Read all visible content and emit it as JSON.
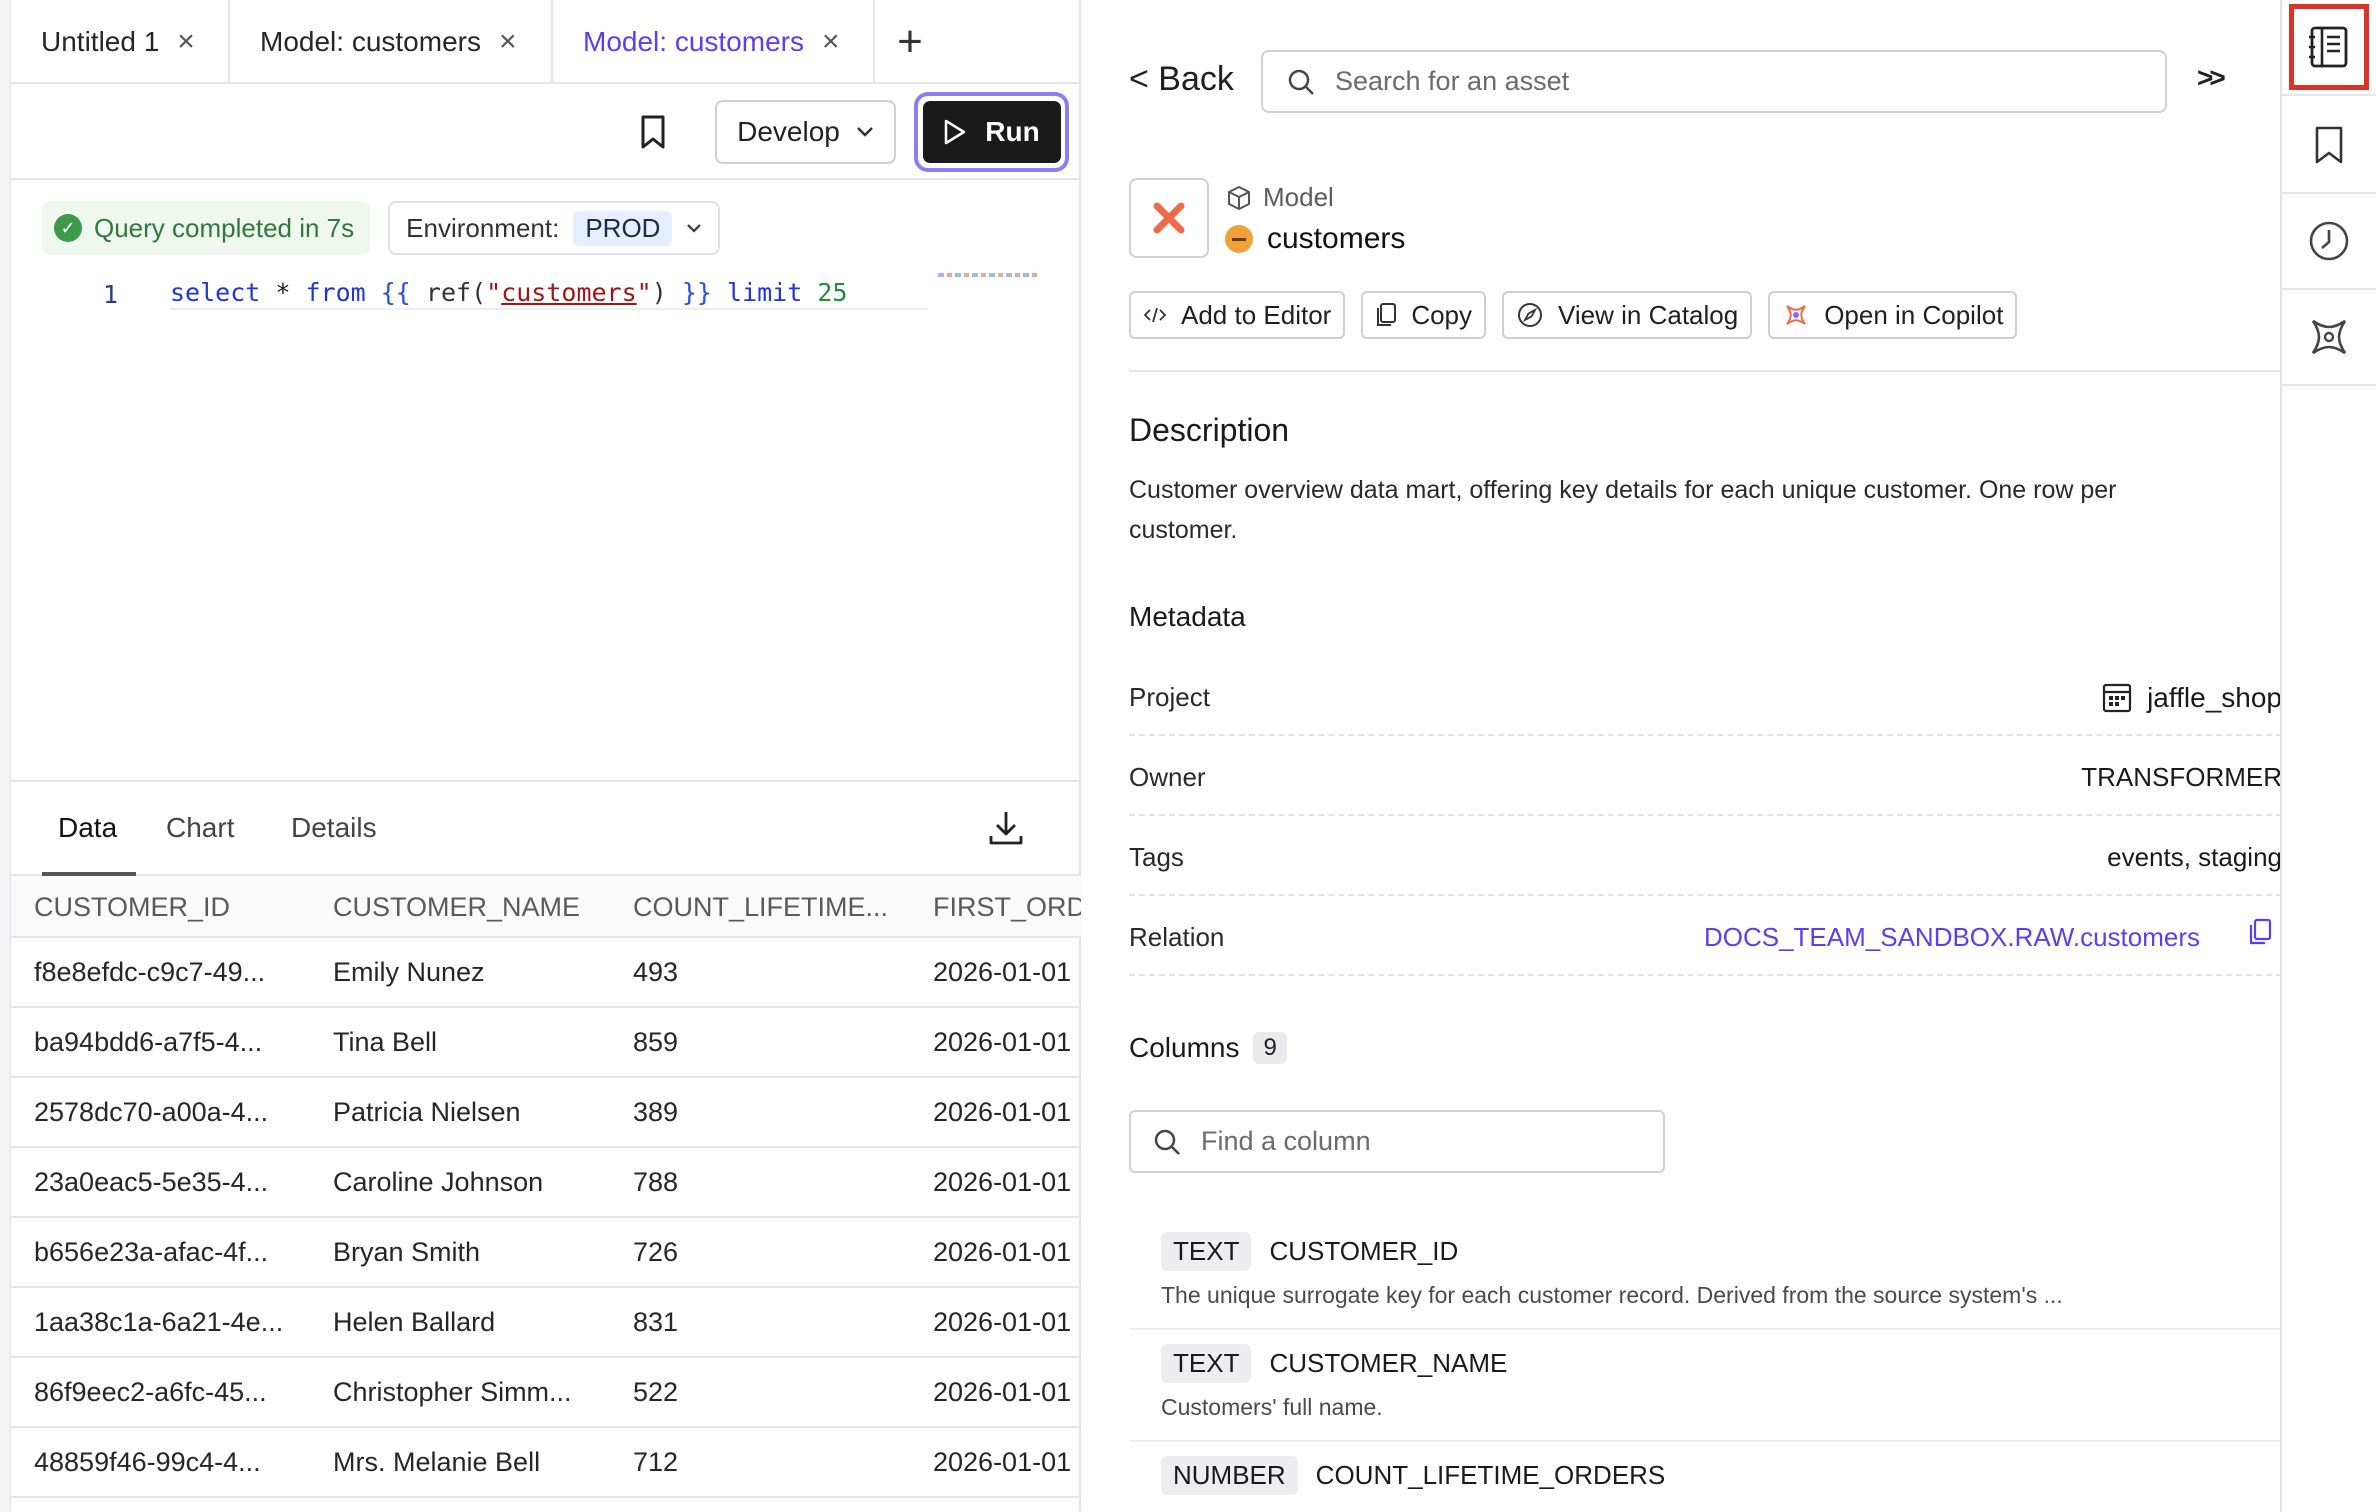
{
  "tabs": [
    {
      "label": "Untitled 1"
    },
    {
      "label": "Model: customers"
    },
    {
      "label": "Model: customers",
      "active": true
    }
  ],
  "toolbar": {
    "develop_label": "Develop",
    "run_label": "Run"
  },
  "status": {
    "query_text": "Query completed in 7s",
    "env_label": "Environment:",
    "env_value": "PROD"
  },
  "editor": {
    "line_number": "1",
    "code": "select * from {{ ref(\"customers\") }} limit 25"
  },
  "results": {
    "tabs": [
      "Data",
      "Chart",
      "Details"
    ],
    "active_tab": "Data",
    "columns": [
      "CUSTOMER_ID",
      "CUSTOMER_NAME",
      "COUNT_LIFETIME...",
      "FIRST_ORDI"
    ],
    "rows": [
      [
        "f8e8efdc-c9c7-49...",
        "Emily Nunez",
        "493",
        "2026-01-01"
      ],
      [
        "ba94bdd6-a7f5-4...",
        "Tina Bell",
        "859",
        "2026-01-01"
      ],
      [
        "2578dc70-a00a-4...",
        "Patricia Nielsen",
        "389",
        "2026-01-01"
      ],
      [
        "23a0eac5-5e35-4...",
        "Caroline Johnson",
        "788",
        "2026-01-01"
      ],
      [
        "b656e23a-afac-4f...",
        "Bryan Smith",
        "726",
        "2026-01-01"
      ],
      [
        "1aa38c1a-6a21-4e...",
        "Helen Ballard",
        "831",
        "2026-01-01"
      ],
      [
        "86f9eec2-a6fc-45...",
        "Christopher Simm...",
        "522",
        "2026-01-01"
      ],
      [
        "48859f46-99c4-4...",
        "Mrs. Melanie Bell",
        "712",
        "2026-01-01"
      ]
    ]
  },
  "catalog": {
    "back_label": "< Back",
    "search_placeholder": "Search for an asset",
    "collapse_label": ">>",
    "asset_type": "Model",
    "asset_name": "customers",
    "actions": {
      "add_to_editor": "Add to Editor",
      "copy": "Copy",
      "view_in_catalog": "View in Catalog",
      "open_in_copilot": "Open in Copilot"
    },
    "description_title": "Description",
    "description": "Customer overview data mart, offering key details for each unique customer. One row per customer.",
    "metadata_title": "Metadata",
    "metadata": {
      "project_label": "Project",
      "project_value": "jaffle_shop",
      "owner_label": "Owner",
      "owner_value": "TRANSFORMER",
      "tags_label": "Tags",
      "tags_value": "events, staging",
      "relation_label": "Relation",
      "relation_value": "DOCS_TEAM_SANDBOX.RAW.customers"
    },
    "columns_title": "Columns",
    "columns_count": "9",
    "column_search_placeholder": "Find a column",
    "column_list": [
      {
        "type": "TEXT",
        "name": "CUSTOMER_ID",
        "desc": "The unique surrogate key for each customer record. Derived from the source system's ..."
      },
      {
        "type": "TEXT",
        "name": "CUSTOMER_NAME",
        "desc": "Customers' full name."
      },
      {
        "type": "NUMBER",
        "name": "COUNT_LIFETIME_ORDERS",
        "desc": ""
      }
    ]
  },
  "colors": {
    "accent": "#5b3ef0",
    "success": "#3c9a4a",
    "highlight_border": "#d9332a"
  },
  "icons": {
    "rail": [
      "catalog-icon",
      "bookmark-icon",
      "history-icon",
      "copilot-icon"
    ]
  }
}
